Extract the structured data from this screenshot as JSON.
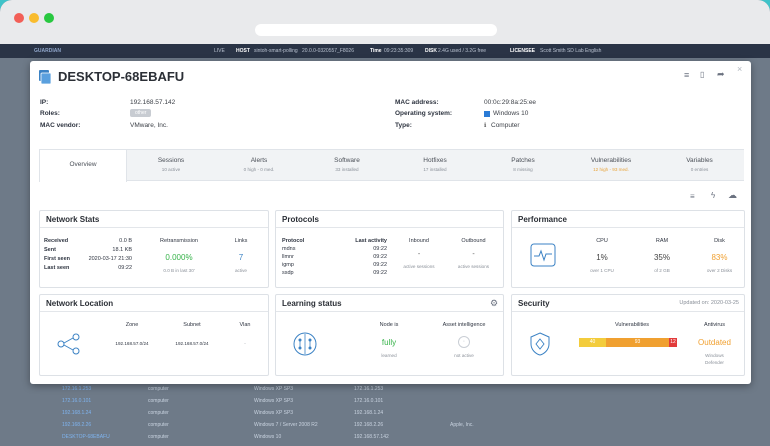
{
  "topnav": {
    "brand": "GUARDIAN",
    "live": "LIVE",
    "host_label": "HOST",
    "host_value": "sintoh-smart-polling",
    "build": "20.0.0-0320557_F8026",
    "time_label": "Time",
    "time_value": "09:23:35:309",
    "disk_label": "DISK",
    "disk_value": "2.4G used / 3.2G free",
    "licensee_label": "LICENSEE",
    "licensee_value": "Scott Smith SD Lab",
    "language": "English"
  },
  "background_rows": [
    {
      "ip": "172.16.1.253",
      "type": "computer",
      "os": "Windows XP SP3",
      "ip2": "172.16.1.253",
      "vendor": ""
    },
    {
      "ip": "172.16.0.101",
      "type": "computer",
      "os": "Windows XP SP3",
      "ip2": "172.16.0.101",
      "vendor": ""
    },
    {
      "ip": "192.168.1.24",
      "type": "computer",
      "os": "Windows XP SP3",
      "ip2": "192.168.1.24",
      "vendor": ""
    },
    {
      "ip": "192.168.2.26",
      "type": "computer",
      "os": "Windows 7 / Server 2008 R2",
      "ip2": "192.168.2.26",
      "vendor": "Apple, Inc."
    },
    {
      "ip": "DESKTOP-68EBAFU",
      "type": "computer",
      "os": "Windows 10",
      "ip2": "192.168.57.142",
      "vendor": ""
    }
  ],
  "modal": {
    "title": "DESKTOP-68EBAFU",
    "info": {
      "ip_label": "IP:",
      "ip_value": "192.168.57.142",
      "roles_label": "Roles:",
      "roles_value": "other",
      "mac_vendor_label": "MAC vendor:",
      "mac_vendor_value": "VMware, Inc.",
      "mac_label": "MAC address:",
      "mac_value": "00:0c:29:8a:25:ee",
      "os_label": "Operating system:",
      "os_value": "Windows 10",
      "type_label": "Type:",
      "type_value": "Computer"
    },
    "tabs": [
      {
        "label": "Overview",
        "sub": ""
      },
      {
        "label": "Sessions",
        "sub": "10 active"
      },
      {
        "label": "Alerts",
        "sub": "0 high - 0 med."
      },
      {
        "label": "Software",
        "sub": "33 installed"
      },
      {
        "label": "Hotfixes",
        "sub": "17 installed"
      },
      {
        "label": "Patches",
        "sub": "8 missing"
      },
      {
        "label": "Vulnerabilities",
        "sub": "12 high - 93 med."
      },
      {
        "label": "Variables",
        "sub": "0 entries"
      }
    ],
    "network_stats": {
      "title": "Network Stats",
      "received_label": "Received",
      "received_value": "0.0 B",
      "sent_label": "Sent",
      "sent_value": "18.1 KB",
      "first_seen_label": "First seen",
      "first_seen_value": "2020-03-17 21:30",
      "last_seen_label": "Last seen",
      "last_seen_value": "09:22",
      "retrans_label": "Retransmission",
      "retrans_value": "0.000%",
      "retrans_sub": "0.0 B in last 30'",
      "links_label": "Links",
      "links_value": "7",
      "links_sub": "active"
    },
    "protocols": {
      "title": "Protocols",
      "col_protocol": "Protocol",
      "col_last": "Last activity",
      "col_inbound": "Inbound",
      "col_outbound": "Outbound",
      "rows": [
        {
          "name": "mdns",
          "last": "09:22"
        },
        {
          "name": "llmnr",
          "last": "09:22"
        },
        {
          "name": "igmp",
          "last": "09:22"
        },
        {
          "name": "ssdp",
          "last": "09:22"
        }
      ],
      "inbound_value": "-",
      "outbound_value": "-",
      "inbound_sub": "active sessions",
      "outbound_sub": "active sessions"
    },
    "performance": {
      "title": "Performance",
      "cpu_label": "CPU",
      "cpu_value": "1%",
      "cpu_sub": "over 1 CPU",
      "ram_label": "RAM",
      "ram_value": "35%",
      "ram_sub": "of 2 GB",
      "disk_label": "Disk",
      "disk_value": "83%",
      "disk_sub": "over 2 Disks"
    },
    "network_location": {
      "title": "Network Location",
      "zone_label": "Zone",
      "zone_value": "192.168.57.0/24",
      "subnet_label": "Subnet",
      "subnet_value": "192.168.57.0/24",
      "vlan_label": "Vlan",
      "vlan_value": "-"
    },
    "learning": {
      "title": "Learning status",
      "node_label": "Node is",
      "node_value": "fully",
      "node_sub": "learned",
      "ai_label": "Asset intelligence",
      "ai_sub": "not active"
    },
    "security": {
      "title": "Security",
      "updated": "Updated on: 2020-03-25",
      "vuln_label": "Vulnerabilities",
      "vuln_low": 40,
      "vuln_med": 93,
      "vuln_high": 12,
      "antivirus_label": "Antivirus",
      "antivirus_value": "Outdated",
      "antivirus_sub1": "Windows",
      "antivirus_sub2": "Defender"
    }
  },
  "colors": {
    "accent": "#3b82c4",
    "green": "#37b34a",
    "orange": "#f0a030",
    "red": "#e23b3b",
    "yellow": "#f3cc3c",
    "background": "#3fc3c9"
  }
}
